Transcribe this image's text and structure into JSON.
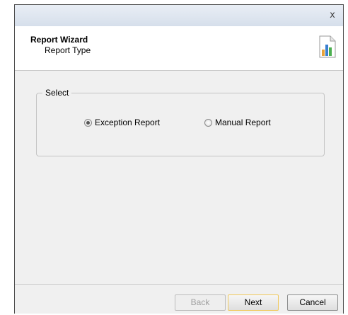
{
  "titlebar": {
    "close_glyph": "x"
  },
  "header": {
    "title": "Report Wizard",
    "subtitle": "Report Type",
    "icon": "report-chart-icon"
  },
  "select_group": {
    "legend": "Select",
    "options": [
      {
        "label": "Exception Report",
        "checked": true
      },
      {
        "label": "Manual Report",
        "checked": false
      }
    ]
  },
  "footer": {
    "back_label": "Back",
    "next_label": "Next",
    "cancel_label": "Cancel"
  }
}
